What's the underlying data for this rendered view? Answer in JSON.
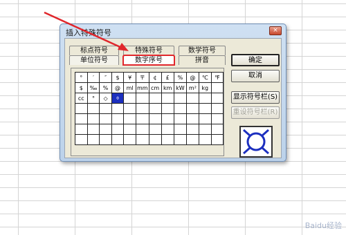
{
  "dialog": {
    "title": "插入特殊符号",
    "close": "×"
  },
  "tabs": {
    "row1": [
      "标点符号",
      "特殊符号",
      "数学符号"
    ],
    "row2": [
      "单位符号",
      "数字序号",
      "拼音"
    ],
    "active": "单位符号",
    "highlighted": "数字序号"
  },
  "symbols": {
    "rows": [
      [
        "°",
        "′",
        "″",
        "$",
        "¥",
        "〒",
        "¢",
        "£",
        "%",
        "@",
        "℃",
        "℉"
      ],
      [
        "$",
        "‰",
        "%",
        "@",
        "ml",
        "mm",
        "cm",
        "km",
        "kW",
        "m²",
        "kg",
        ""
      ],
      [
        "cc",
        "°",
        "◇",
        "⌽",
        "",
        "",
        "",
        "",
        "",
        "",
        "",
        ""
      ],
      [
        "",
        "",
        "",
        "",
        "",
        "",
        "",
        "",
        "",
        "",
        "",
        ""
      ],
      [
        "",
        "",
        "",
        "",
        "",
        "",
        "",
        "",
        "",
        "",
        "",
        ""
      ],
      [
        "",
        "",
        "",
        "",
        "",
        "",
        "",
        "",
        "",
        "",
        "",
        ""
      ],
      [
        "",
        "",
        "",
        "",
        "",
        "",
        "",
        "",
        "",
        "",
        "",
        ""
      ]
    ]
  },
  "buttons": {
    "ok": "确定",
    "cancel": "取消",
    "show_bar": "显示符号栏(S)",
    "reset_bar": "重设符号栏(R)"
  },
  "watermark": "Baidu经验"
}
